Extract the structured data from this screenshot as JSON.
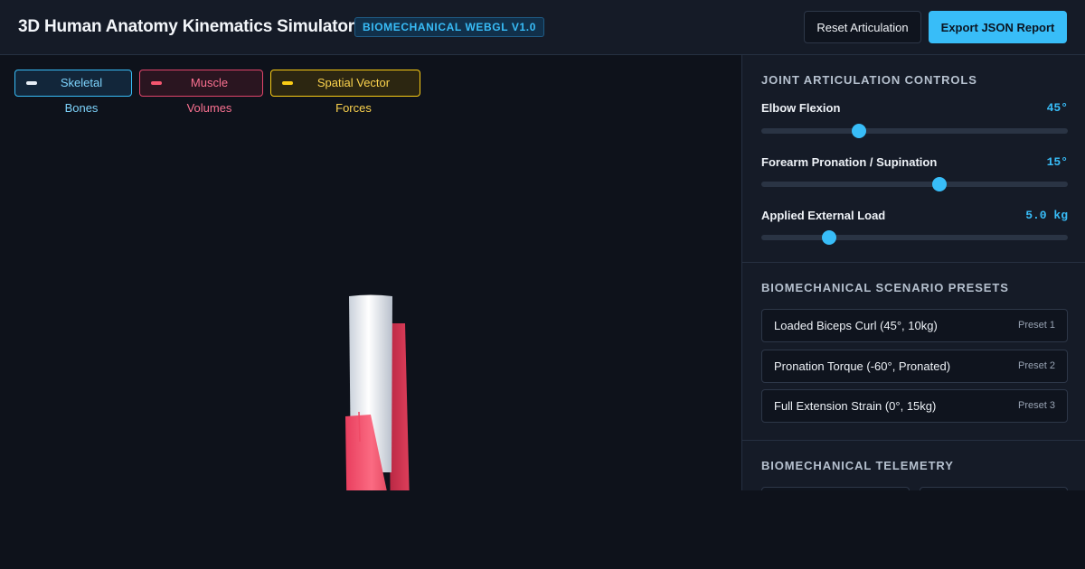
{
  "header": {
    "title": "3D Human Anatomy Kinematics Simulator",
    "badge": "BIOMECHANICAL WEBGL V1.0",
    "reset_label": "Reset Articulation",
    "export_label": "Export JSON Report"
  },
  "layers": [
    {
      "label": "Skeletal Bones",
      "icon": "bone-layer-swatch"
    },
    {
      "label": "Muscle Volumes",
      "icon": "muscle-layer-swatch"
    },
    {
      "label": "Spatial Vector Forces",
      "icon": "vector-layer-swatch"
    }
  ],
  "controls": {
    "title": "JOINT ARTICULATION CONTROLS",
    "sliders": [
      {
        "label": "Elbow Flexion",
        "value": "45°",
        "fill_fraction": 0.32
      },
      {
        "label": "Forearm Pronation / Supination",
        "value": "15°",
        "fill_fraction": 0.58
      },
      {
        "label": "Applied External Load",
        "value": "5.0 kg",
        "fill_fraction": 0.22
      }
    ]
  },
  "presets": {
    "title": "BIOMECHANICAL SCENARIO PRESETS",
    "items": [
      {
        "name": "Loaded Biceps Curl (45°, 10kg)",
        "tag": "Preset 1"
      },
      {
        "name": "Pronation Torque (-60°, Pronated)",
        "tag": "Preset 2"
      },
      {
        "name": "Full Extension Strain (0°, 15kg)",
        "tag": "Preset 3"
      }
    ]
  },
  "telemetry": {
    "title": "BIOMECHANICAL TELEMETRY"
  },
  "colors": {
    "accent": "#38bdf8",
    "bone": "#e6edf5",
    "muscle": "#f4566f",
    "vector": "#facc15",
    "background": "#0e121b",
    "panel": "#151b27"
  }
}
